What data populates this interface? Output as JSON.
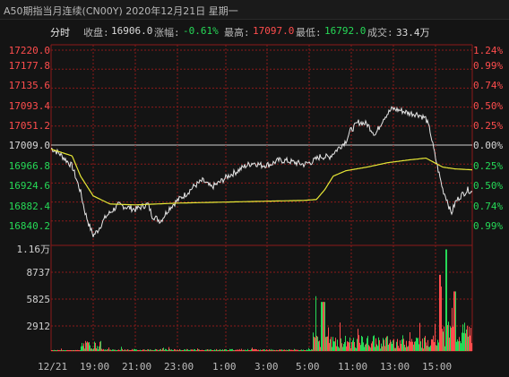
{
  "window": {
    "title": "A50期指当月连续(CN00Y) 2020年12月21日 星期一"
  },
  "infobar": {
    "tab_label": "分时",
    "close_label": "收盘:",
    "close_value": "16906.0",
    "change_label": "涨幅:",
    "change_value": "-0.61%",
    "high_label": "最高:",
    "high_value": "17097.0",
    "low_label": "最低:",
    "low_value": "16792.0",
    "volume_label": "成交:",
    "volume_value": "33.4万"
  },
  "price_axis": {
    "left": [
      "17220.0",
      "17177.8",
      "17135.6",
      "17093.4",
      "17051.2",
      "17009.0",
      "16966.8",
      "16924.6",
      "16882.4",
      "16840.2"
    ],
    "right": [
      "1.24%",
      "0.99%",
      "0.74%",
      "0.50%",
      "0.25%",
      "0.00%",
      "0.25%",
      "0.50%",
      "0.74%",
      "0.99%"
    ],
    "reference_index": 5,
    "min": 16798.0,
    "max": 17220.0
  },
  "volume_axis": {
    "labels": [
      "1.16万",
      "8737",
      "5825",
      "2912"
    ]
  },
  "time_axis": {
    "labels": [
      "12/21",
      "19:00",
      "21:00",
      "23:00",
      "1:00",
      "3:00",
      "5:00",
      "11:00",
      "13:00",
      "15:00"
    ]
  },
  "colors": {
    "background": "#141414",
    "grid": "#8b1a1a",
    "reference_line": "#d0d0d0",
    "price_line": "#e8e8e8",
    "average_line": "#e8e836",
    "up": "#ff4d4d",
    "down": "#26d957"
  }
}
